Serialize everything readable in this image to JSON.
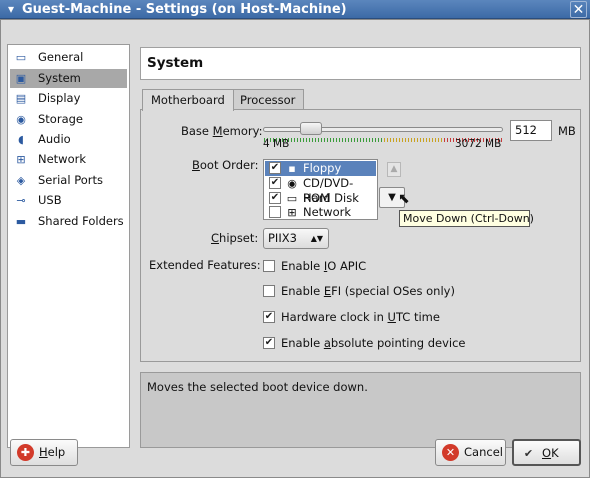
{
  "window": {
    "title": "Guest-Machine - Settings (on Host-Machine)",
    "menu_icon": "▾",
    "close_glyph": "✕"
  },
  "sidebar": {
    "items": [
      {
        "label": "General",
        "icon": "monitor-icon",
        "glyph": "▭"
      },
      {
        "label": "System",
        "icon": "chip-icon",
        "glyph": "▣",
        "selected": true
      },
      {
        "label": "Display",
        "icon": "display-icon",
        "glyph": "▤"
      },
      {
        "label": "Storage",
        "icon": "disk-icon",
        "glyph": "◉"
      },
      {
        "label": "Audio",
        "icon": "speaker-icon",
        "glyph": "◖"
      },
      {
        "label": "Network",
        "icon": "network-icon",
        "glyph": "⊞"
      },
      {
        "label": "Serial Ports",
        "icon": "serial-port-icon",
        "glyph": "◈"
      },
      {
        "label": "USB",
        "icon": "usb-icon",
        "glyph": "⊸"
      },
      {
        "label": "Shared Folders",
        "icon": "folder-icon",
        "glyph": "▬"
      }
    ]
  },
  "header": {
    "title": "System"
  },
  "tabs": [
    {
      "label": "Motherboard",
      "active": true
    },
    {
      "label": "Processor",
      "active": false
    }
  ],
  "motherboard": {
    "base_memory": {
      "label_pre": "Base ",
      "label_u": "M",
      "label_post": "emory:",
      "value": "512",
      "unit": "MB",
      "min_label": "4 MB",
      "max_label": "3072 MB",
      "fraction": 0.165
    },
    "boot_order": {
      "label_pre": "",
      "label_u": "B",
      "label_post": "oot Order:",
      "items": [
        {
          "label": "Floppy",
          "checked": true,
          "icon": "floppy-icon",
          "glyph": "▪",
          "selected": true
        },
        {
          "label": "CD/DVD-ROM",
          "checked": true,
          "icon": "cd-icon",
          "glyph": "◉",
          "selected": false
        },
        {
          "label": "Hard Disk",
          "checked": true,
          "icon": "hard-disk-icon",
          "glyph": "▭",
          "selected": false
        },
        {
          "label": "Network",
          "checked": false,
          "icon": "network-icon",
          "glyph": "⊞",
          "selected": false
        }
      ],
      "up_glyph": "▲",
      "down_glyph": "▼",
      "tooltip": "Move Down (Ctrl-Down)"
    },
    "chipset": {
      "label_pre": "",
      "label_u": "C",
      "label_post": "hipset:",
      "value": "PIIX3",
      "arrow": "▲▼"
    },
    "extended_features": {
      "label": "Extended Features:",
      "items": [
        {
          "pre": "Enable ",
          "u": "I",
          "post": "O APIC",
          "checked": false
        },
        {
          "pre": "Enable ",
          "u": "E",
          "post": "FI (special OSes only)",
          "checked": false
        },
        {
          "pre": "Hardware clock in ",
          "u": "U",
          "post": "TC time",
          "checked": true
        },
        {
          "pre": "Enable ",
          "u": "a",
          "post": "bsolute pointing device",
          "checked": true
        }
      ]
    }
  },
  "description": "Moves the selected boot device down.",
  "buttons": {
    "help": {
      "pre": "",
      "u": "H",
      "post": "elp",
      "glyph": "✚"
    },
    "cancel": {
      "label": "Cancel",
      "glyph": "✕"
    },
    "ok": {
      "pre": "",
      "u": "O",
      "post": "K",
      "glyph": "✔"
    }
  },
  "colors": {
    "titlebar": "#3c6aa6",
    "selection": "#5a82bb",
    "sidebar_selection": "#a8a8a8",
    "tooltip_bg": "#ffffe1",
    "cancel_red": "#d23a2a"
  }
}
